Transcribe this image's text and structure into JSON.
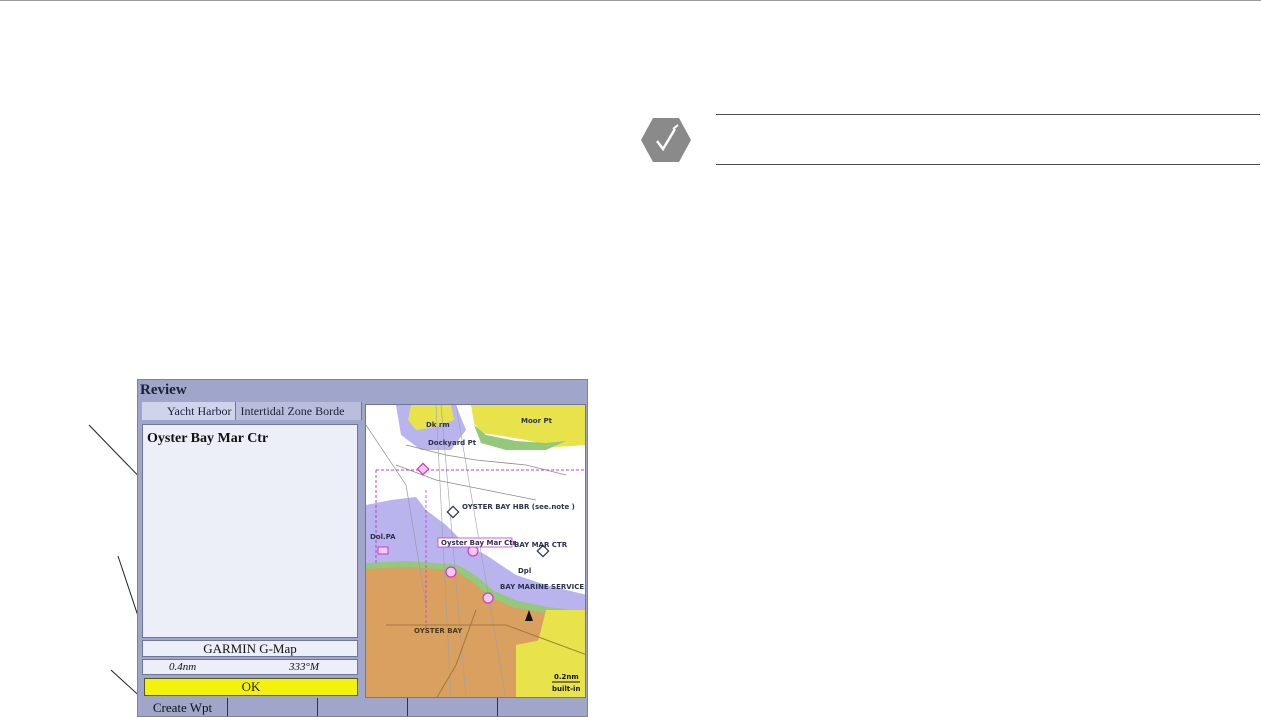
{
  "device": {
    "title": "Review",
    "tabs": [
      {
        "label": "Yacht Harbor"
      },
      {
        "label": "Intertidal Zone Borde"
      }
    ],
    "selected_name": "Oyster Bay Mar Ctr",
    "data_source": "GARMIN G-Map",
    "distance": "0.4nm",
    "bearing": "333°M",
    "ok_label": "OK",
    "softkeys": [
      {
        "label": "Create Wpt"
      },
      {
        "label": ""
      },
      {
        "label": ""
      },
      {
        "label": ""
      },
      {
        "label": ""
      }
    ]
  },
  "map": {
    "labels": {
      "dk_rm": "Dk rm",
      "moor_pt": "Moor Pt",
      "dockyard_pt": "Dockyard Pt",
      "oyster_bay_hbr": "OYSTER BAY HBR (see.note )",
      "dol_pa": "Dol.PA",
      "selected_tag": "Oyster Bay Mar Ctr",
      "bay_mar_ctr": "BAY MAR CTR",
      "dpl": "Dpl",
      "bay_marine_services": "BAY MARINE SERVICES",
      "oyster_bay": "OYSTER BAY",
      "scale_value": "0.2nm",
      "scale_sub": "built-in"
    },
    "colors": {
      "land": "#e8e34a",
      "green": "#94c87a",
      "water_shallow": "#b9b4ee",
      "water_deep": "#ffffff",
      "built_area": "#d9a060",
      "marker": "#c83cc8"
    }
  }
}
